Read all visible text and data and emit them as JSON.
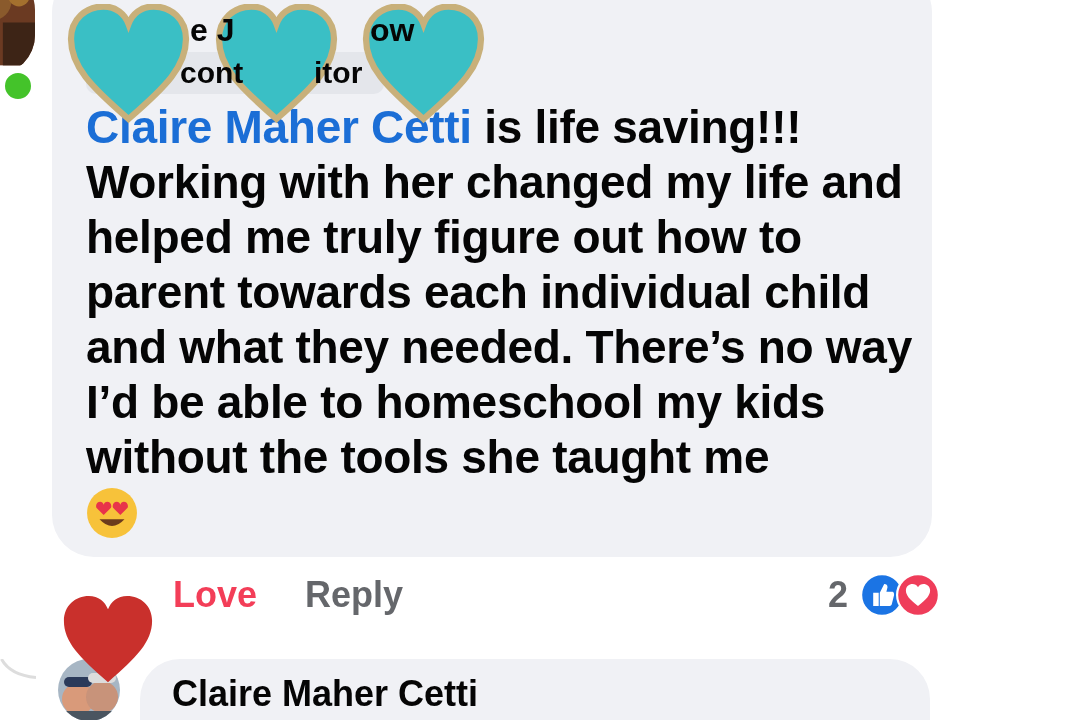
{
  "comment": {
    "author_fragments": [
      "e J",
      "ow"
    ],
    "badge_fragments": [
      "cont",
      "itor"
    ],
    "online": true,
    "mention": "Claire Maher Cetti",
    "text": "is life saving!!! Working with her changed my life and helped me truly figure out how to parent towards each individual child and what they needed. There’s no way I’d be able to homeschool my kids without the tools she taught me"
  },
  "actions": [
    {
      "label": "Love",
      "selected": true
    },
    {
      "label": "Reply",
      "selected": false
    }
  ],
  "reaction_count": "2",
  "reply": {
    "author": "Claire Maher Cetti"
  },
  "stickers": [
    {
      "color": "#3abfc5"
    },
    {
      "color": "#3abfc5"
    },
    {
      "color": "#3abfc5"
    },
    {
      "color": "#c9302c"
    }
  ]
}
